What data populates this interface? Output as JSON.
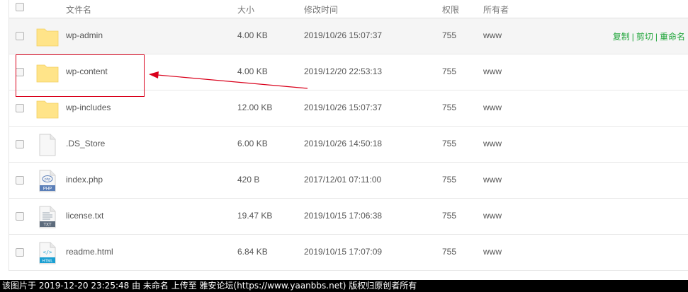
{
  "header": {
    "name": "文件名",
    "size": "大小",
    "modified": "修改时间",
    "permission": "权限",
    "owner": "所有者"
  },
  "operations": {
    "copy": "复制",
    "cut": "剪切",
    "rename": "重命名",
    "separator": "|"
  },
  "files": [
    {
      "name": "wp-admin",
      "size": "4.00 KB",
      "modified": "2019/10/26 15:07:37",
      "permission": "755",
      "owner": "www",
      "type": "folder-icon"
    },
    {
      "name": "wp-content",
      "size": "4.00 KB",
      "modified": "2019/12/20 22:53:13",
      "permission": "755",
      "owner": "www",
      "type": "folder-icon"
    },
    {
      "name": "wp-includes",
      "size": "12.00 KB",
      "modified": "2019/10/26 15:07:37",
      "permission": "755",
      "owner": "www",
      "type": "folder-icon"
    },
    {
      "name": ".DS_Store",
      "size": "6.00 KB",
      "modified": "2019/10/26 14:50:18",
      "permission": "755",
      "owner": "www",
      "type": "blank-file-icon"
    },
    {
      "name": "index.php",
      "size": "420 B",
      "modified": "2017/12/01 07:11:00",
      "permission": "755",
      "owner": "www",
      "type": "php-file-icon",
      "badge": "PHP",
      "glyph": "php"
    },
    {
      "name": "license.txt",
      "size": "19.47 KB",
      "modified": "2019/10/15 17:06:38",
      "permission": "755",
      "owner": "www",
      "type": "txt-file-icon",
      "badge": "TXT"
    },
    {
      "name": "readme.html",
      "size": "6.84 KB",
      "modified": "2019/10/15 17:07:09",
      "permission": "755",
      "owner": "www",
      "type": "html-file-icon",
      "badge": "HTML",
      "glyph": "</>"
    }
  ],
  "footer": {
    "text": "该图片于 2019-12-20 23:25:48 由 未命名 上传至 雅安论坛(https://www.yaanbbs.net) 版权归原创者所有"
  },
  "colors": {
    "accent": "#20a53a",
    "highlight": "#d9001b",
    "folder": "#ffe489",
    "php_badge": "#5b7fb8",
    "txt_badge": "#5d6b7c",
    "html_badge": "#1a9fd2"
  }
}
